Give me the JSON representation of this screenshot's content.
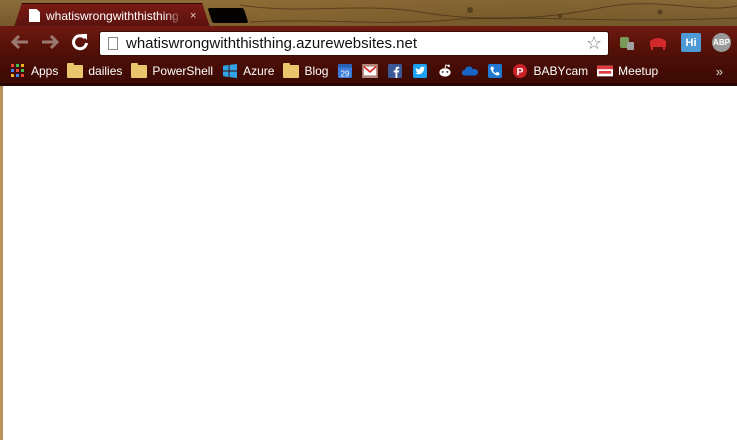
{
  "window": {
    "tab": {
      "title": "whatiswrongwiththisthing",
      "close_glyph": "×"
    }
  },
  "toolbar": {
    "back_glyph": "⬅",
    "forward_glyph": "➡",
    "reload_glyph": "↻",
    "url": "whatiswrongwiththisthing.azurewebsites.net",
    "star_glyph": "☆",
    "extensions": [
      {
        "name": "evernote-icon"
      },
      {
        "name": "pocket-red-icon"
      },
      {
        "name": "hi-icon",
        "label": "Hi"
      },
      {
        "name": "adblock-plus-icon",
        "label": "ABP"
      }
    ]
  },
  "bookmarks": {
    "items": [
      {
        "label": "Apps",
        "icon": "apps-grid-icon"
      },
      {
        "label": "dailies",
        "icon": "folder-icon"
      },
      {
        "label": "PowerShell",
        "icon": "folder-icon"
      },
      {
        "label": "Azure",
        "icon": "windows-logo-icon"
      },
      {
        "label": "Blog",
        "icon": "folder-icon"
      },
      {
        "label": "",
        "icon": "calendar-icon",
        "text": "29"
      },
      {
        "label": "",
        "icon": "gmail-icon"
      },
      {
        "label": "",
        "icon": "facebook-icon"
      },
      {
        "label": "",
        "icon": "twitter-icon"
      },
      {
        "label": "",
        "icon": "reddit-icon"
      },
      {
        "label": "",
        "icon": "onedrive-icon"
      },
      {
        "label": "",
        "icon": "phone-icon"
      },
      {
        "label": "BABYcam",
        "icon": "pinterest-icon"
      },
      {
        "label": "Meetup",
        "icon": "meetup-icon"
      }
    ],
    "overflow_glyph": "»"
  },
  "colors": {
    "toolbar": "#5a1208",
    "bookmarks_bar": "#400b04",
    "folder": "#e9c66b",
    "hi_badge": "#4d9ad6"
  }
}
